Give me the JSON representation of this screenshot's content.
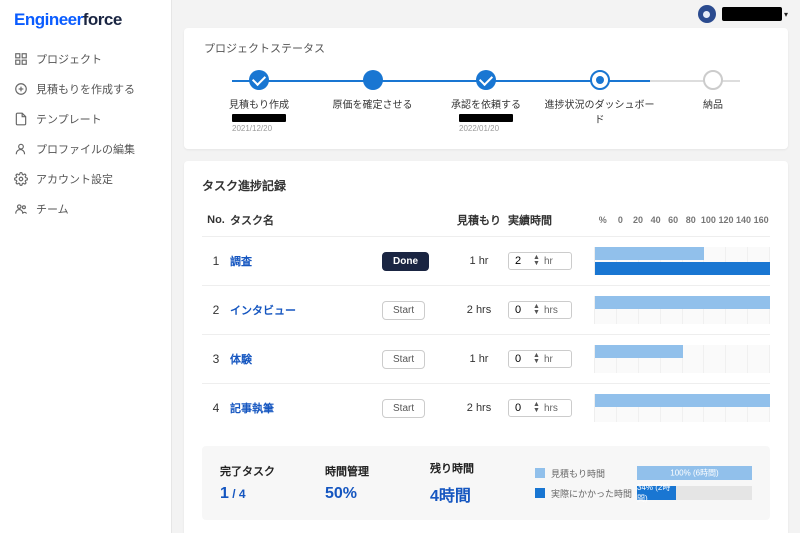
{
  "logo": {
    "part1": "Engineer",
    "part2": "force"
  },
  "topbar": {
    "chevron": "▾"
  },
  "sidebar": {
    "items": [
      {
        "label": "プロジェクト"
      },
      {
        "label": "見積もりを作成する"
      },
      {
        "label": "テンプレート"
      },
      {
        "label": "プロファイルの編集"
      },
      {
        "label": "アカウント設定"
      },
      {
        "label": "チーム"
      }
    ]
  },
  "status_card": {
    "title": "プロジェクトステータス",
    "steps": [
      {
        "label": "見積もり作成",
        "date": "2021/12/20",
        "has_black": true
      },
      {
        "label": "原価を確定させる"
      },
      {
        "label": "承認を依頼する",
        "date": "2022/01/20",
        "has_black": true
      },
      {
        "label": "進捗状況のダッシュボード"
      },
      {
        "label": "納品"
      }
    ]
  },
  "tasks": {
    "title": "タスク進捗記録",
    "headers": {
      "no": "No.",
      "name": "タスク名",
      "est": "見積もり",
      "actual": "実績時間"
    },
    "scale_labels": [
      "%",
      "0",
      "20",
      "40",
      "60",
      "80",
      "100",
      "120",
      "140",
      "160"
    ],
    "btn_done": "Done",
    "btn_start": "Start",
    "rows": [
      {
        "no": "1",
        "name": "調査",
        "est": "1 hr",
        "actual_value": "2",
        "unit": "hr",
        "done": true,
        "bar_est_pct": 62,
        "bar_act_pct": 100
      },
      {
        "no": "2",
        "name": "インタビュー",
        "est": "2 hrs",
        "actual_value": "0",
        "unit": "hrs",
        "done": false,
        "bar_est_pct": 100,
        "bar_act_pct": 0
      },
      {
        "no": "3",
        "name": "体験",
        "est": "1 hr",
        "actual_value": "0",
        "unit": "hr",
        "done": false,
        "bar_est_pct": 50,
        "bar_act_pct": 0
      },
      {
        "no": "4",
        "name": "記事執筆",
        "est": "2 hrs",
        "actual_value": "0",
        "unit": "hrs",
        "done": false,
        "bar_est_pct": 100,
        "bar_act_pct": 0
      }
    ]
  },
  "summary": {
    "stats": [
      {
        "label": "完了タスク",
        "value": "1",
        "suffix": " / 4"
      },
      {
        "label": "時間管理",
        "value": "50%"
      },
      {
        "label": "残り時間",
        "value": "4時間"
      }
    ],
    "legend": {
      "est_label": "見積もり時間",
      "act_label": "実際にかかった時間",
      "est_bar_text": "100% (6時間)",
      "act_bar_text": "34% (2時間)",
      "act_bar_width_pct": 34
    }
  }
}
